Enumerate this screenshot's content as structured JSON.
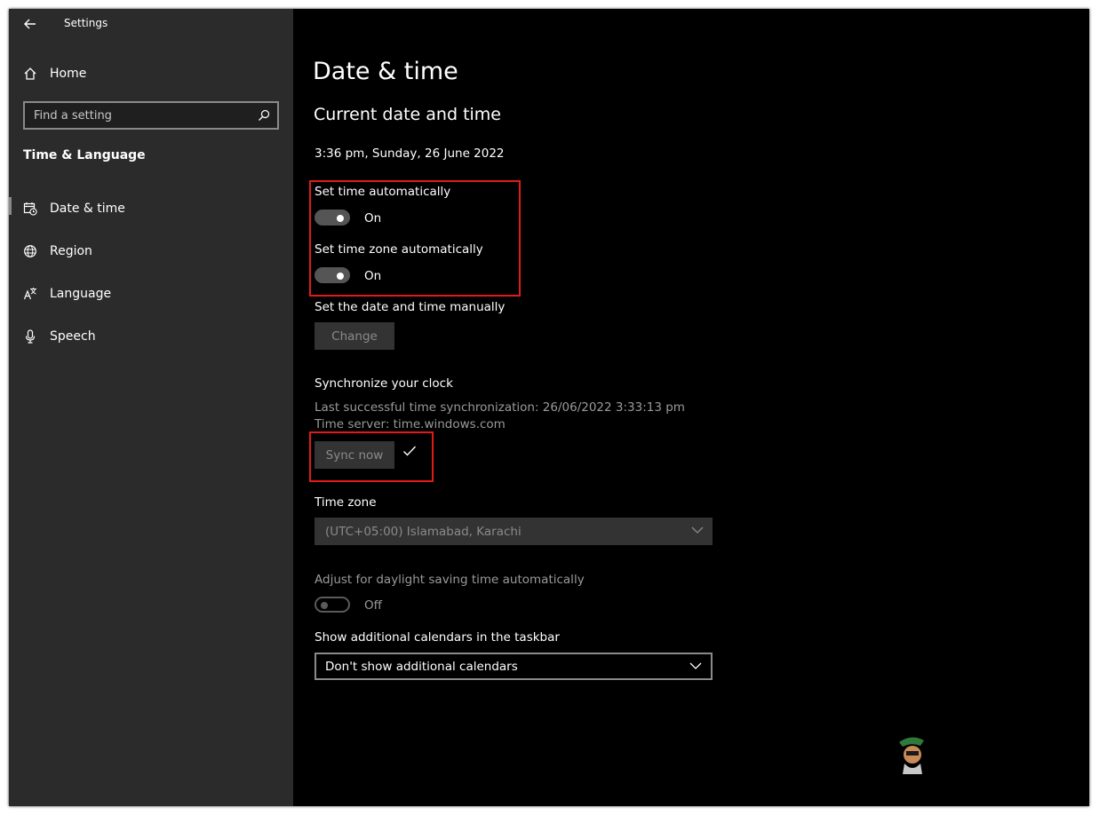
{
  "window": {
    "title": "Settings"
  },
  "sidebar": {
    "home_label": "Home",
    "search_placeholder": "Find a setting",
    "section_title": "Time & Language",
    "items": [
      {
        "label": "Date & time",
        "icon": "calendar-clock-icon"
      },
      {
        "label": "Region",
        "icon": "globe-icon"
      },
      {
        "label": "Language",
        "icon": "language-icon"
      },
      {
        "label": "Speech",
        "icon": "microphone-icon"
      }
    ]
  },
  "main": {
    "title": "Date & time",
    "subtitle": "Current date and time",
    "current_datetime": "3:36 pm, Sunday, 26 June 2022",
    "set_time_auto": {
      "label": "Set time automatically",
      "state": "On"
    },
    "set_timezone_auto": {
      "label": "Set time zone automatically",
      "state": "On"
    },
    "manual": {
      "label": "Set the date and time manually",
      "button": "Change"
    },
    "sync": {
      "heading": "Synchronize your clock",
      "last_sync": "Last successful time synchronization: 26/06/2022 3:33:13 pm",
      "server": "Time server: time.windows.com",
      "button": "Sync now"
    },
    "timezone": {
      "label": "Time zone",
      "value": "(UTC+05:00) Islamabad, Karachi"
    },
    "daylight": {
      "label": "Adjust for daylight saving time automatically",
      "state": "Off"
    },
    "calendars": {
      "label": "Show additional calendars in the taskbar",
      "value": "Don't show additional calendars"
    }
  },
  "colors": {
    "highlight": "#e21a1a",
    "sidebar_bg": "#2b2b2b",
    "main_bg": "#000000"
  }
}
